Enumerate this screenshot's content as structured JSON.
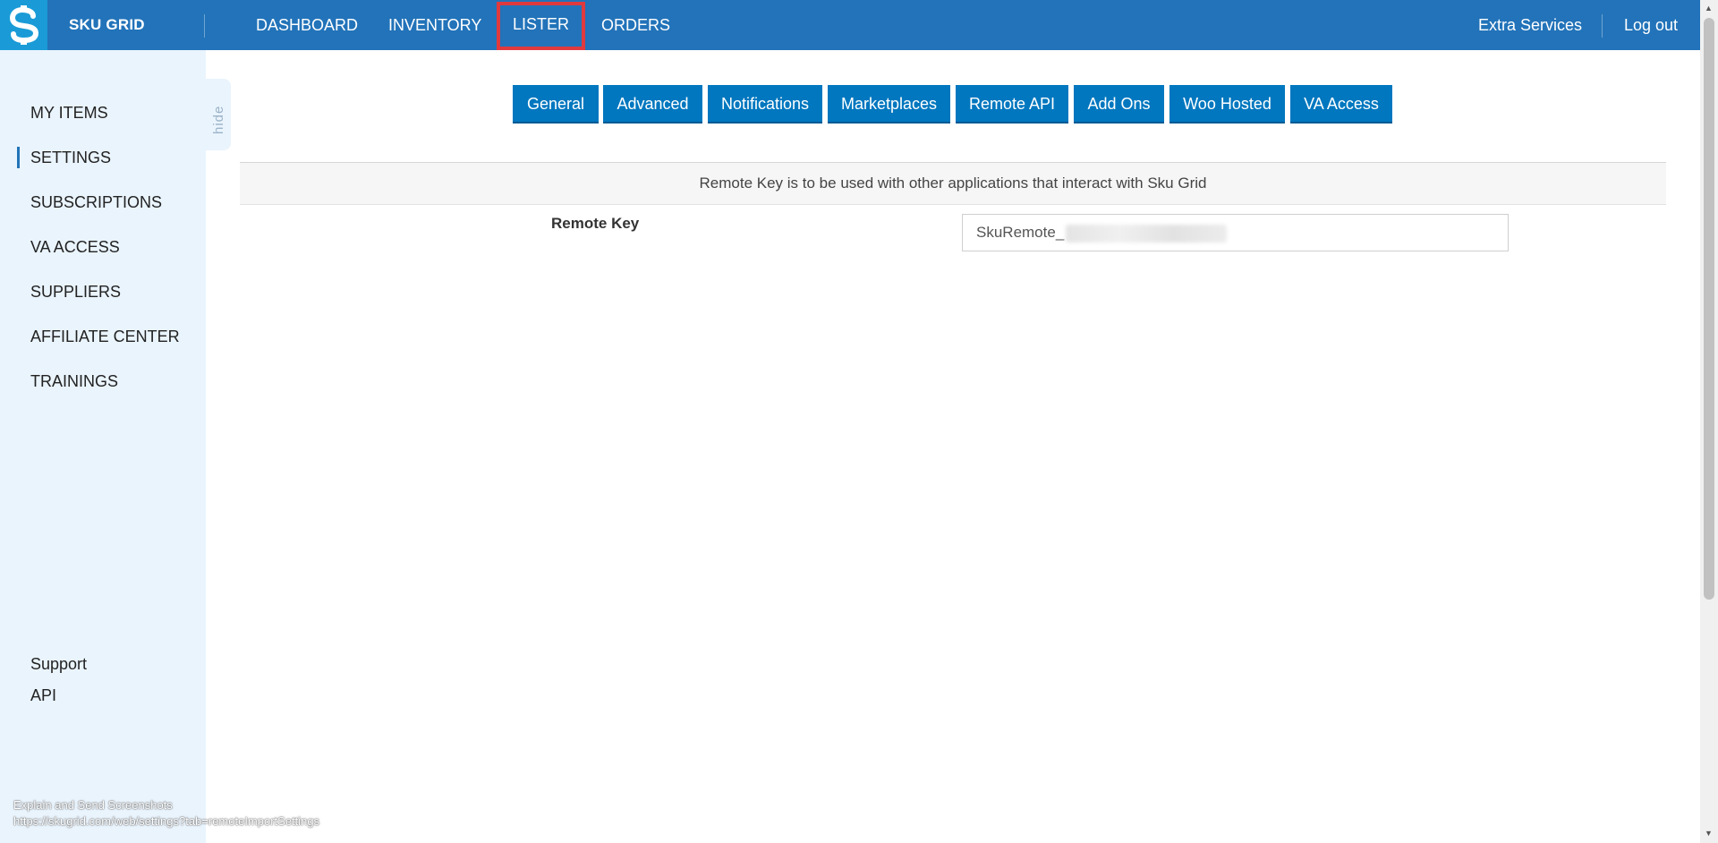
{
  "header": {
    "brand": "SKU GRID",
    "nav": [
      "DASHBOARD",
      "INVENTORY",
      "LISTER",
      "ORDERS"
    ],
    "right": [
      "Extra Services",
      "Log out"
    ]
  },
  "sidebar": {
    "items": [
      "MY ITEMS",
      "SETTINGS",
      "SUBSCRIPTIONS",
      "VA ACCESS",
      "SUPPLIERS",
      "AFFILIATE CENTER",
      "TRAININGS"
    ],
    "bottom": [
      "Support",
      "API"
    ],
    "hide_label": "hide"
  },
  "tabs": [
    "General",
    "Advanced",
    "Notifications",
    "Marketplaces",
    "Remote API",
    "Add Ons",
    "Woo Hosted",
    "VA Access"
  ],
  "content": {
    "info": "Remote Key is to be used with other applications that interact with Sku Grid",
    "remote_key_label": "Remote Key",
    "remote_key_value": "SkuRemote_"
  },
  "footer": {
    "line1": "Explain and Send Screenshots",
    "line2": "https://skugrid.com/web/settings?tab=remoteImportSettings"
  },
  "colors": {
    "header": "#2273b9",
    "tab": "#0077bf",
    "sidebar": "#eaf4fd",
    "highlight": "#e0393e"
  }
}
